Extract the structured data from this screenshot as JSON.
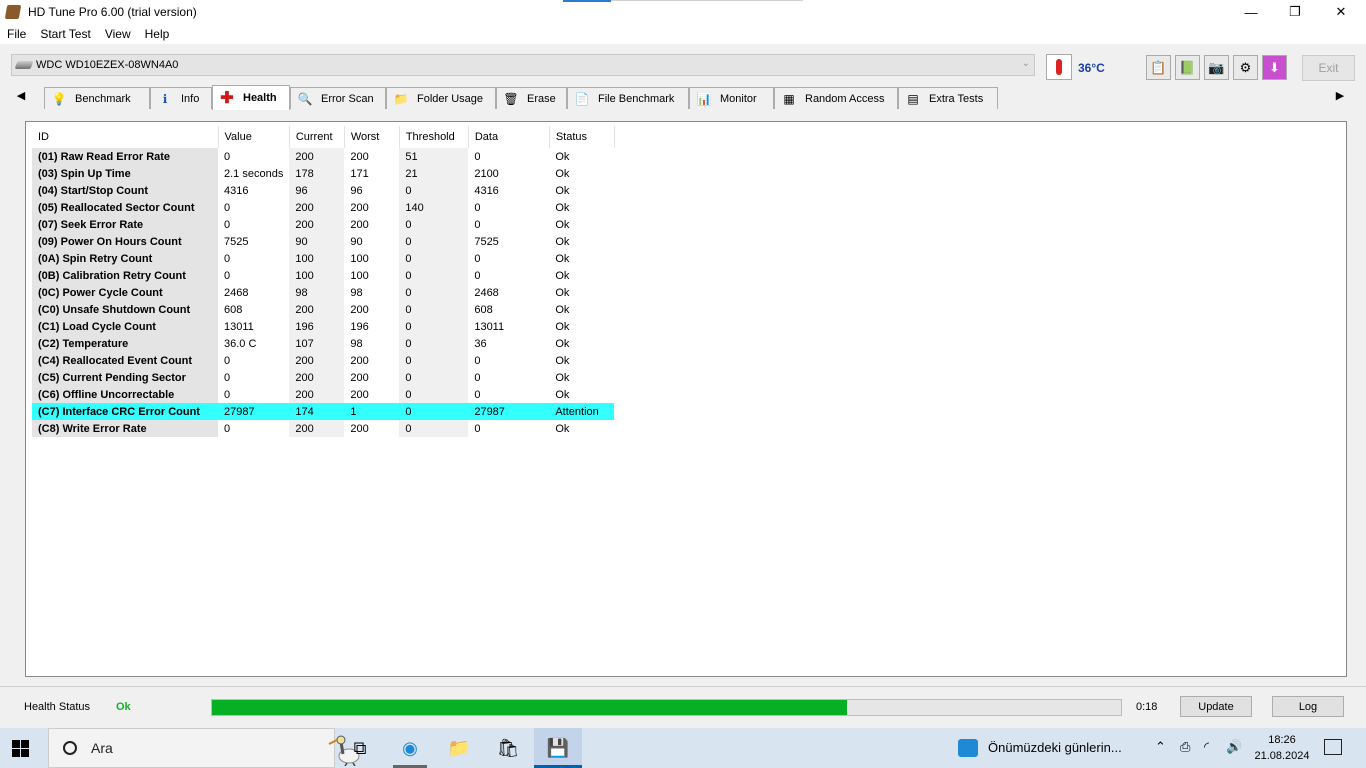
{
  "window": {
    "title": "HD Tune Pro 6.00 (trial version)",
    "minimize": "—",
    "maximize": "❐",
    "close": "✕"
  },
  "menu": [
    "File",
    "Start Test",
    "View",
    "Help"
  ],
  "drive": {
    "name": "WDC WD10EZEX-08WN4A0",
    "temperature": "36°C"
  },
  "toolbar": {
    "exit_label": "Exit"
  },
  "tabs": [
    "Benchmark",
    "Info",
    "Health",
    "Error Scan",
    "Folder Usage",
    "Erase",
    "File Benchmark",
    "Monitor",
    "Random Access",
    "Extra Tests"
  ],
  "active_tab": "Health",
  "smart": {
    "headers": {
      "id": "ID",
      "value": "Value",
      "current": "Current",
      "worst": "Worst",
      "threshold": "Threshold",
      "data": "Data",
      "status": "Status"
    },
    "rows": [
      [
        "(01) Raw Read Error Rate",
        "0",
        "200",
        "200",
        "51",
        "0",
        "Ok"
      ],
      [
        "(03) Spin Up Time",
        "2.1 seconds",
        "178",
        "171",
        "21",
        "2100",
        "Ok"
      ],
      [
        "(04) Start/Stop Count",
        "4316",
        "96",
        "96",
        "0",
        "4316",
        "Ok"
      ],
      [
        "(05) Reallocated Sector Count",
        "0",
        "200",
        "200",
        "140",
        "0",
        "Ok"
      ],
      [
        "(07) Seek Error Rate",
        "0",
        "200",
        "200",
        "0",
        "0",
        "Ok"
      ],
      [
        "(09) Power On Hours Count",
        "7525",
        "90",
        "90",
        "0",
        "7525",
        "Ok"
      ],
      [
        "(0A) Spin Retry Count",
        "0",
        "100",
        "100",
        "0",
        "0",
        "Ok"
      ],
      [
        "(0B) Calibration Retry Count",
        "0",
        "100",
        "100",
        "0",
        "0",
        "Ok"
      ],
      [
        "(0C) Power Cycle Count",
        "2468",
        "98",
        "98",
        "0",
        "2468",
        "Ok"
      ],
      [
        "(C0) Unsafe Shutdown Count",
        "608",
        "200",
        "200",
        "0",
        "608",
        "Ok"
      ],
      [
        "(C1) Load Cycle Count",
        "13011",
        "196",
        "196",
        "0",
        "13011",
        "Ok"
      ],
      [
        "(C2) Temperature",
        "36.0 C",
        "107",
        "98",
        "0",
        "36",
        "Ok"
      ],
      [
        "(C4) Reallocated Event Count",
        "0",
        "200",
        "200",
        "0",
        "0",
        "Ok"
      ],
      [
        "(C5) Current Pending Sector",
        "0",
        "200",
        "200",
        "0",
        "0",
        "Ok"
      ],
      [
        "(C6) Offline Uncorrectable",
        "0",
        "200",
        "200",
        "0",
        "0",
        "Ok"
      ],
      [
        "(C7) Interface CRC Error Count",
        "27987",
        "174",
        "1",
        "0",
        "27987",
        "Attention"
      ],
      [
        "(C8) Write Error Rate",
        "0",
        "200",
        "200",
        "0",
        "0",
        "Ok"
      ]
    ]
  },
  "status": {
    "label": "Health Status",
    "value": "Ok",
    "progress_fraction": 0.699,
    "time": "0:18",
    "update_label": "Update",
    "log_label": "Log"
  },
  "taskbar": {
    "search_placeholder": "Ara",
    "news": "Önümüzdeki günlerin...",
    "time": "18:26",
    "date": "21.08.2024"
  },
  "colors": {
    "attention_row": "#33ffff",
    "ok_green": "#16b22b",
    "progress": "#06b025",
    "temp_blue": "#1a3fa8"
  }
}
